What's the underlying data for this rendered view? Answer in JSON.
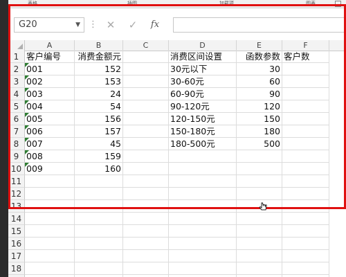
{
  "ribbon": {
    "groups": [
      "表格",
      "插图",
      "加载项",
      "图表"
    ]
  },
  "formula_bar": {
    "name_box": "G20",
    "cancel_glyph": "✕",
    "enter_glyph": "✓",
    "fx_label": "fx",
    "formula": ""
  },
  "columns": [
    "A",
    "B",
    "C",
    "D",
    "E",
    "F"
  ],
  "rows": [
    {
      "num": "1",
      "A": "客户编号",
      "B": "消费金额元",
      "C": "",
      "D": "消费区间设置",
      "E": "函数参数",
      "F": "客户数"
    },
    {
      "num": "2",
      "A": "001",
      "B": "152",
      "C": "",
      "D": "30元以下",
      "E": "30",
      "F": ""
    },
    {
      "num": "3",
      "A": "002",
      "B": "153",
      "C": "",
      "D": "30-60元",
      "E": "60",
      "F": ""
    },
    {
      "num": "4",
      "A": "003",
      "B": "24",
      "C": "",
      "D": "60-90元",
      "E": "90",
      "F": ""
    },
    {
      "num": "5",
      "A": "004",
      "B": "54",
      "C": "",
      "D": "90-120元",
      "E": "120",
      "F": ""
    },
    {
      "num": "6",
      "A": "005",
      "B": "156",
      "C": "",
      "D": "120-150元",
      "E": "150",
      "F": ""
    },
    {
      "num": "7",
      "A": "006",
      "B": "157",
      "C": "",
      "D": "150-180元",
      "E": "180",
      "F": ""
    },
    {
      "num": "8",
      "A": "007",
      "B": "45",
      "C": "",
      "D": "180-500元",
      "E": "500",
      "F": ""
    },
    {
      "num": "9",
      "A": "008",
      "B": "159",
      "C": "",
      "D": "",
      "E": "",
      "F": ""
    },
    {
      "num": "10",
      "A": "009",
      "B": "160",
      "C": "",
      "D": "",
      "E": "",
      "F": ""
    },
    {
      "num": "11",
      "A": "",
      "B": "",
      "C": "",
      "D": "",
      "E": "",
      "F": ""
    },
    {
      "num": "12",
      "A": "",
      "B": "",
      "C": "",
      "D": "",
      "E": "",
      "F": ""
    },
    {
      "num": "13",
      "A": "",
      "B": "",
      "C": "",
      "D": "",
      "E": "",
      "F": ""
    },
    {
      "num": "14",
      "A": "",
      "B": "",
      "C": "",
      "D": "",
      "E": "",
      "F": ""
    },
    {
      "num": "15",
      "A": "",
      "B": "",
      "C": "",
      "D": "",
      "E": "",
      "F": ""
    },
    {
      "num": "16",
      "A": "",
      "B": "",
      "C": "",
      "D": "",
      "E": "",
      "F": ""
    },
    {
      "num": "17",
      "A": "",
      "B": "",
      "C": "",
      "D": "",
      "E": "",
      "F": ""
    },
    {
      "num": "18",
      "A": "",
      "B": "",
      "C": "",
      "D": "",
      "E": "",
      "F": ""
    },
    {
      "num": "19",
      "A": "",
      "B": "",
      "C": "",
      "D": "",
      "E": "",
      "F": ""
    }
  ],
  "text_cells_with_indicator": [
    "A2",
    "A3",
    "A4",
    "A5",
    "A6",
    "A7",
    "A8",
    "A9",
    "A10"
  ],
  "colors": {
    "highlight_box": "#e01010",
    "error_indicator": "#2e7d32",
    "scroll_thumb": "#2f8f4f"
  }
}
